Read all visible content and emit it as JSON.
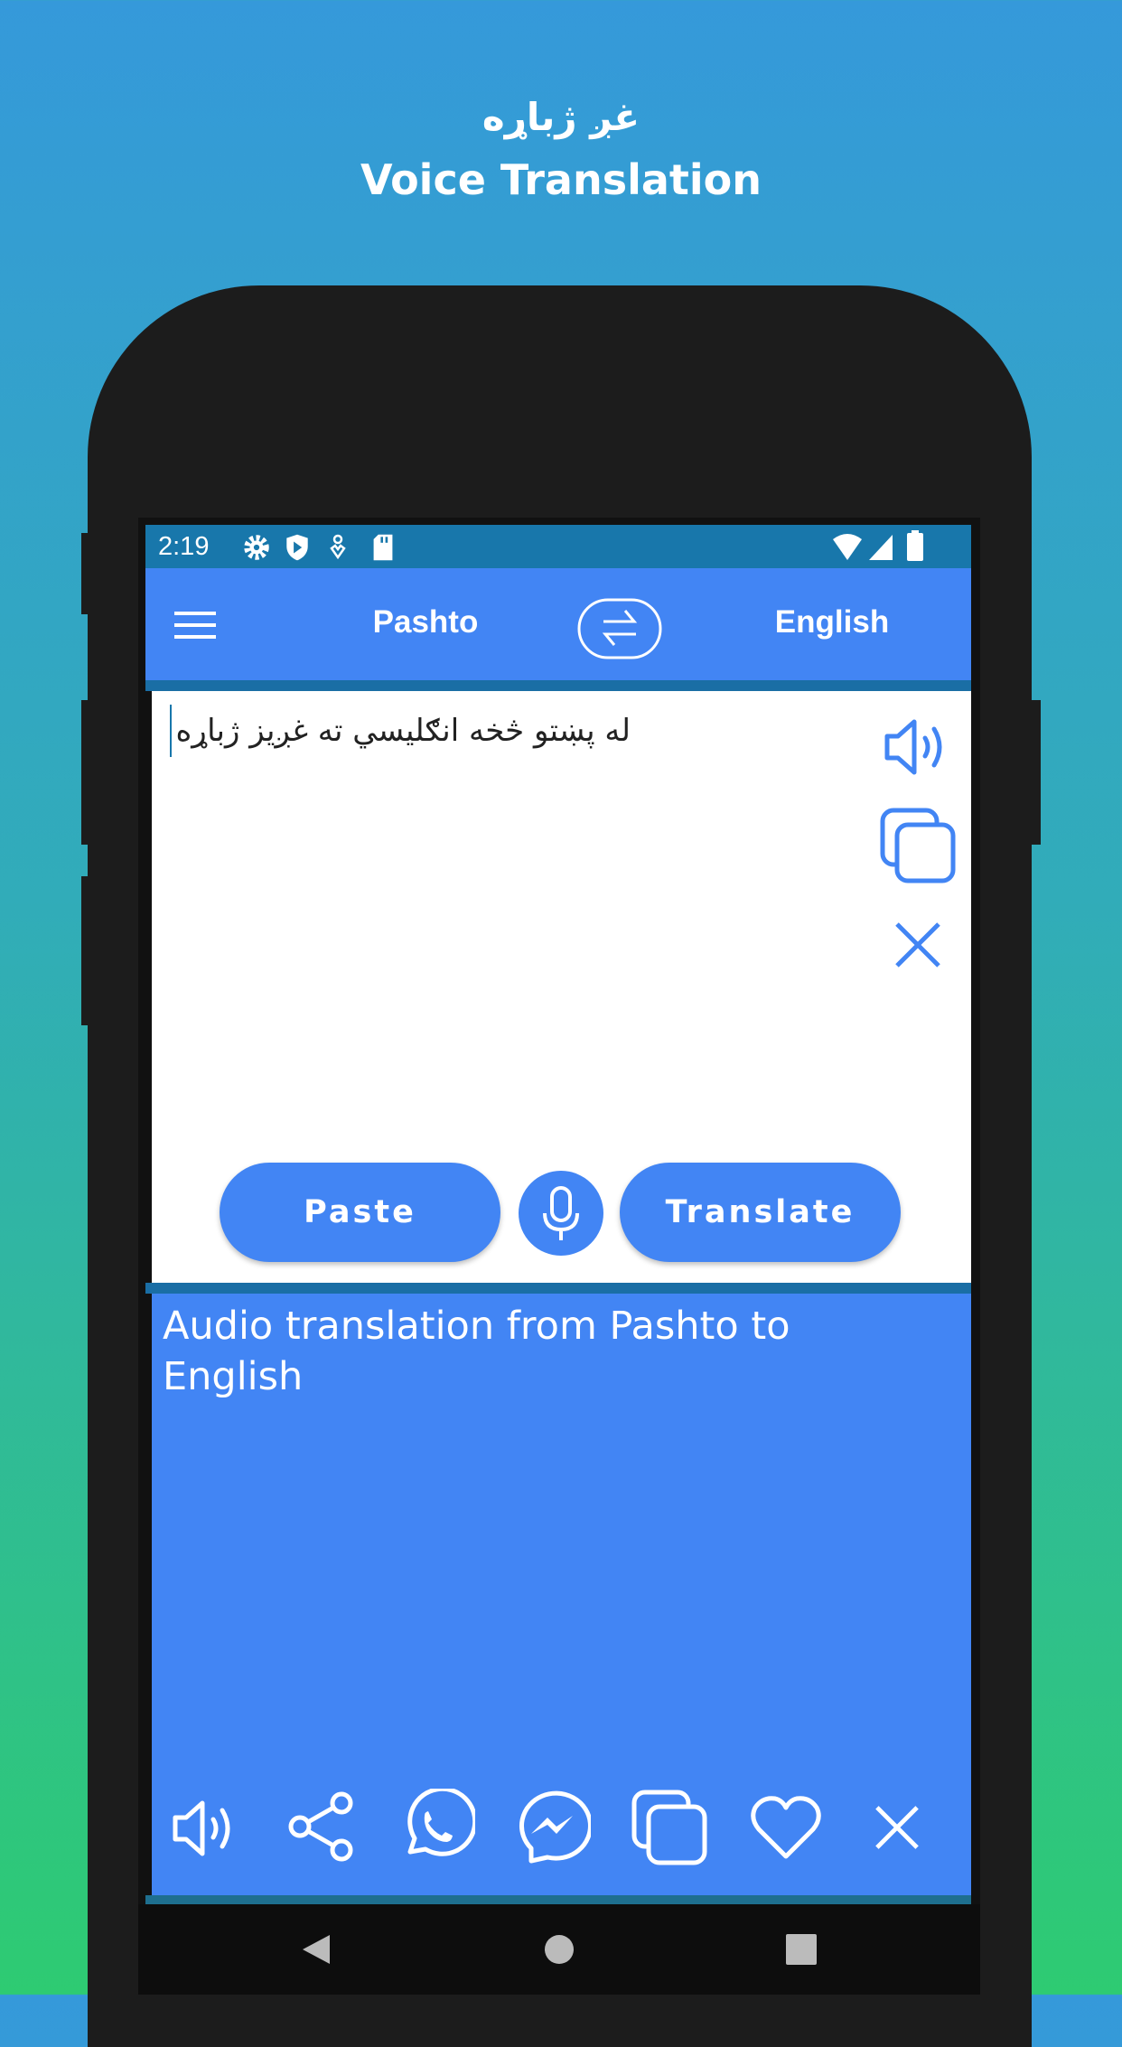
{
  "promo": {
    "title_pashto": "غږ ژباړه",
    "title_english": "Voice Translation"
  },
  "status_bar": {
    "time": "2:19",
    "left_icons": [
      "gear-icon",
      "shield-play-icon",
      "location-icon",
      "sd-card-icon"
    ],
    "right_icons": [
      "wifi-icon",
      "signal-icon",
      "battery-icon"
    ]
  },
  "toolbar": {
    "source_language": "Pashto",
    "target_language": "English",
    "swap_icon": "swap-arrows-icon",
    "menu_icon": "hamburger-icon"
  },
  "input": {
    "value": "له پښتو څخه انګلیسي ته غږیز ژباړه",
    "icons": [
      "speaker-icon",
      "copy-icon",
      "close-icon"
    ]
  },
  "buttons": {
    "paste": "Paste",
    "translate": "Translate",
    "mic_icon": "microphone-icon"
  },
  "output": {
    "text": "Audio translation from Pashto to English",
    "icons": [
      "speaker-icon",
      "share-icon",
      "whatsapp-icon",
      "messenger-icon",
      "copy-icon",
      "heart-icon",
      "close-icon"
    ]
  },
  "colors": {
    "primary": "#4285f4",
    "status": "#1877ab",
    "text": "#222222"
  }
}
